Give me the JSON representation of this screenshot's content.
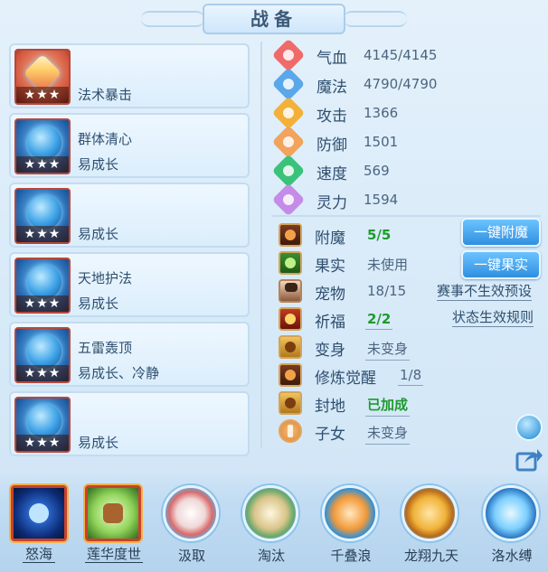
{
  "title": "战备",
  "skills": [
    {
      "line1": "",
      "line2": "法术暴击",
      "stars": "★★★",
      "icon": "fire-pill-icon"
    },
    {
      "line1": "群体清心",
      "line2": "易成长",
      "stars": "★★★",
      "icon": "blue-helmet-icon"
    },
    {
      "line1": "",
      "line2": "易成长",
      "stars": "★★★",
      "icon": "blue-helmet-icon"
    },
    {
      "line1": "天地护法",
      "line2": "易成长",
      "stars": "★★★",
      "icon": "blue-helmet-icon"
    },
    {
      "line1": "五雷轰顶",
      "line2": "易成长、冷静",
      "stars": "★★★",
      "icon": "blue-helmet-icon"
    },
    {
      "line1": "",
      "line2": "易成长",
      "stars": "★★★",
      "icon": "blue-helmet-icon"
    }
  ],
  "stats": [
    {
      "label": "气血",
      "value": "4145/4145",
      "icon": "heart-icon",
      "color": "#f06a6a"
    },
    {
      "label": "魔法",
      "value": "4790/4790",
      "icon": "mana-icon",
      "color": "#5aa7ea"
    },
    {
      "label": "攻击",
      "value": "1366",
      "icon": "sword-icon",
      "color": "#f3b13a"
    },
    {
      "label": "防御",
      "value": "1501",
      "icon": "shield-icon",
      "color": "#f2a35c"
    },
    {
      "label": "速度",
      "value": "569",
      "icon": "lightning-icon",
      "color": "#3bc27a"
    },
    {
      "label": "灵力",
      "value": "1594",
      "icon": "spirit-icon",
      "color": "#c58be8"
    }
  ],
  "extras": {
    "enchant": {
      "label": "附魔",
      "value": "5/5"
    },
    "fruit": {
      "label": "果实",
      "value": "未使用"
    },
    "pet": {
      "label": "宠物",
      "value": "18/15"
    },
    "blessing": {
      "label": "祈福",
      "value": "2/2"
    },
    "transform": {
      "label": "变身",
      "value": "未变身"
    },
    "awaken": {
      "label": "修炼觉醒",
      "value": "1/8"
    },
    "fief": {
      "label": "封地",
      "value": "已加成"
    },
    "children": {
      "label": "子女",
      "value": "未变身"
    }
  },
  "buttons": {
    "one_click_enchant": "一键附魔",
    "one_click_fruit": "一键果实",
    "event_preset": "赛事不生效预设",
    "status_rules": "状态生效规则"
  },
  "bottom_skills": [
    {
      "label": "怒海",
      "icon": "blue-orb-icon"
    },
    {
      "label": "莲华度世",
      "icon": "green-hand-icon"
    },
    {
      "label": "汲取",
      "icon": "red-swirl-icon"
    },
    {
      "label": "淘汰",
      "icon": "sword-slash-icon"
    },
    {
      "label": "千叠浪",
      "icon": "wave-icon"
    },
    {
      "label": "龙翔九天",
      "icon": "dragon-fist-icon"
    },
    {
      "label": "洛水缚",
      "icon": "water-bind-icon"
    }
  ]
}
